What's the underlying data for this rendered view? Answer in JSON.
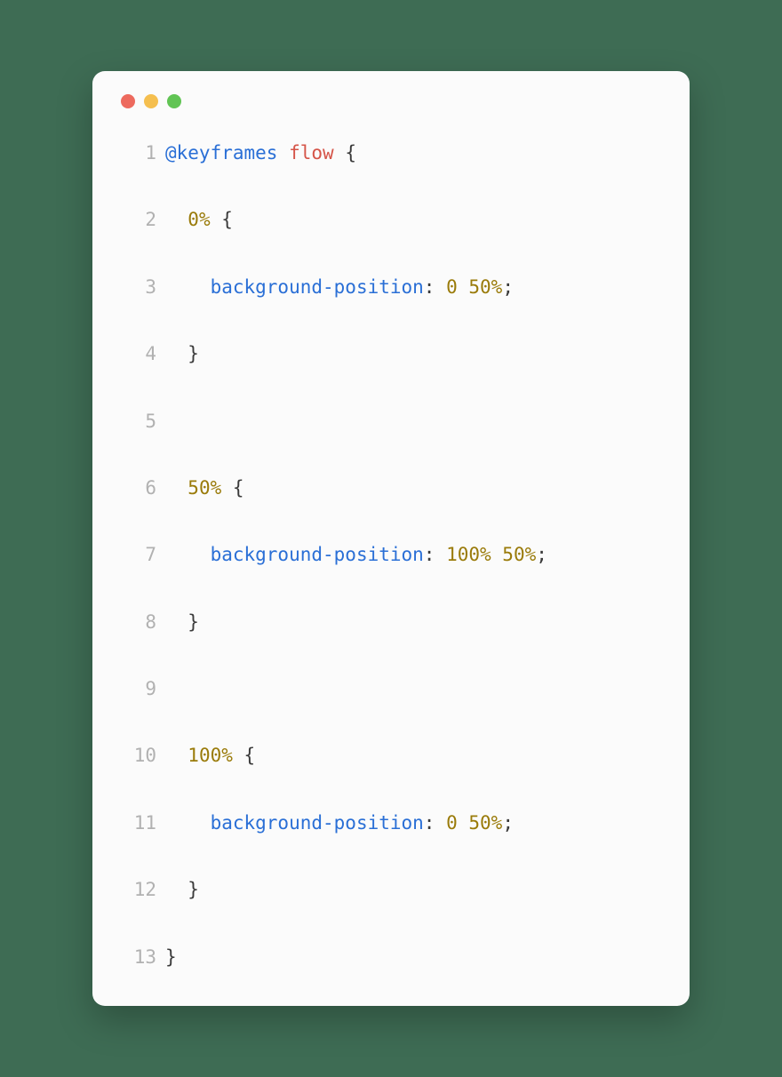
{
  "code": {
    "lines": [
      {
        "num": "1",
        "tokens": [
          {
            "cls": "tok-keyword",
            "text": "@keyframes"
          },
          {
            "cls": "tok-punct",
            "text": " "
          },
          {
            "cls": "tok-name",
            "text": "flow"
          },
          {
            "cls": "tok-punct",
            "text": " {"
          }
        ]
      },
      {
        "num": "2",
        "tokens": [
          {
            "cls": "tok-punct",
            "text": "  "
          },
          {
            "cls": "tok-percent",
            "text": "0%"
          },
          {
            "cls": "tok-punct",
            "text": " {"
          }
        ]
      },
      {
        "num": "3",
        "tokens": [
          {
            "cls": "tok-punct",
            "text": "    "
          },
          {
            "cls": "tok-prop",
            "text": "background-position"
          },
          {
            "cls": "tok-punct",
            "text": ": "
          },
          {
            "cls": "tok-percent",
            "text": "0 50%"
          },
          {
            "cls": "tok-punct",
            "text": ";"
          }
        ]
      },
      {
        "num": "4",
        "tokens": [
          {
            "cls": "tok-punct",
            "text": "  }"
          }
        ]
      },
      {
        "num": "5",
        "tokens": [
          {
            "cls": "tok-punct",
            "text": ""
          }
        ]
      },
      {
        "num": "6",
        "tokens": [
          {
            "cls": "tok-punct",
            "text": "  "
          },
          {
            "cls": "tok-percent",
            "text": "50%"
          },
          {
            "cls": "tok-punct",
            "text": " {"
          }
        ]
      },
      {
        "num": "7",
        "tokens": [
          {
            "cls": "tok-punct",
            "text": "    "
          },
          {
            "cls": "tok-prop",
            "text": "background-position"
          },
          {
            "cls": "tok-punct",
            "text": ": "
          },
          {
            "cls": "tok-percent",
            "text": "100% 50%"
          },
          {
            "cls": "tok-punct",
            "text": ";"
          }
        ]
      },
      {
        "num": "8",
        "tokens": [
          {
            "cls": "tok-punct",
            "text": "  }"
          }
        ]
      },
      {
        "num": "9",
        "tokens": [
          {
            "cls": "tok-punct",
            "text": ""
          }
        ]
      },
      {
        "num": "10",
        "tokens": [
          {
            "cls": "tok-punct",
            "text": "  "
          },
          {
            "cls": "tok-percent",
            "text": "100%"
          },
          {
            "cls": "tok-punct",
            "text": " {"
          }
        ]
      },
      {
        "num": "11",
        "tokens": [
          {
            "cls": "tok-punct",
            "text": "    "
          },
          {
            "cls": "tok-prop",
            "text": "background-position"
          },
          {
            "cls": "tok-punct",
            "text": ": "
          },
          {
            "cls": "tok-percent",
            "text": "0 50%"
          },
          {
            "cls": "tok-punct",
            "text": ";"
          }
        ]
      },
      {
        "num": "12",
        "tokens": [
          {
            "cls": "tok-punct",
            "text": "  }"
          }
        ]
      },
      {
        "num": "13",
        "tokens": [
          {
            "cls": "tok-punct",
            "text": "}"
          }
        ]
      }
    ]
  }
}
